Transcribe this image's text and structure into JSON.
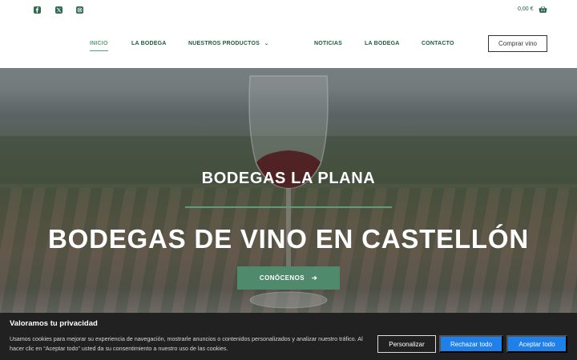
{
  "topbar": {
    "social_icons": [
      "facebook-icon",
      "x-twitter-icon",
      "instagram-icon"
    ],
    "cart_amount": "0,00 €",
    "cart_icon": "shopping-basket-icon"
  },
  "nav": {
    "items": [
      {
        "label": "INICIO",
        "active": true
      },
      {
        "label": "LA BODEGA",
        "active": false
      },
      {
        "label": "NUESTROS PRODUCTOS",
        "active": false,
        "dropdown_icon": "chevron-down-icon"
      },
      {
        "label": "NOTICIAS",
        "active": false
      },
      {
        "label": "LA BODEGA",
        "active": false
      },
      {
        "label": "CONTACTO",
        "active": false
      }
    ],
    "buy_button": "Comprar vino",
    "dropdown_glyph": "⌄"
  },
  "hero": {
    "subtitle": "BODEGAS LA PLANA",
    "title": "BODEGAS DE VINO EN CASTELLÓN",
    "button_label": "CONÓCENOS",
    "button_icon": "arrow-right-icon",
    "arrow_glyph": "➔"
  },
  "cookie": {
    "title": "Valoramos tu privacidad",
    "text": "Usamos cookies para mejorar su experiencia de navegación, mostrarle anuncios o contenidos personalizados y analizar nuestro tráfico. Al hacer clic en “Aceptar todo” usted da su consentimiento a nuestro uso de las cookies.",
    "customize_label": "Personalizar",
    "reject_label": "Rechazar todo",
    "accept_label": "Aceptar todo"
  },
  "colors": {
    "brand_green": "#1f5a3f",
    "accent_green": "#5d9b7d",
    "button_green": "#4f8a6d",
    "cookie_bg": "#212121",
    "cookie_blue": "#1e80e8"
  }
}
